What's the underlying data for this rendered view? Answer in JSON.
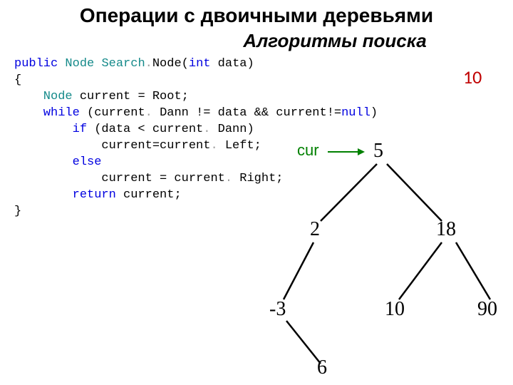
{
  "title_main": "Операции с двоичными деревьями",
  "title_sub": "Алгоритмы поиска",
  "target_value": "10",
  "cur_label": "cur",
  "code": {
    "l1_public": "public",
    "l1_node": " Node ",
    "l1_search": "Search",
    "l1_dot": ".",
    "l1_nodefn": "Node(",
    "l1_int": "int",
    "l1_data": " data)",
    "l2_brace": "{",
    "l3_node": "    Node ",
    "l3_rest": "current = Root;",
    "l4_while": "    while ",
    "l4_a": "(current",
    "l4_dot1": ". ",
    "l4_b": "Dann != data && current!=",
    "l4_null": "null",
    "l4_c": ")",
    "l5_if": "        if ",
    "l5_a": "(data < current",
    "l5_dot": ". ",
    "l5_b": "Dann)",
    "l6_a": "            current=current",
    "l6_dot": ". ",
    "l6_b": "Left;",
    "l7_else": "        else",
    "l8_a": "            current = current",
    "l8_dot": ". ",
    "l8_b": "Right;",
    "l9_return": "        return ",
    "l9_rest": "current;",
    "l10_brace": "}"
  },
  "tree": {
    "n5": "5",
    "n2": "2",
    "n18": "18",
    "nm3": "-3",
    "n10": "10",
    "n90": "90",
    "n6": "6"
  }
}
